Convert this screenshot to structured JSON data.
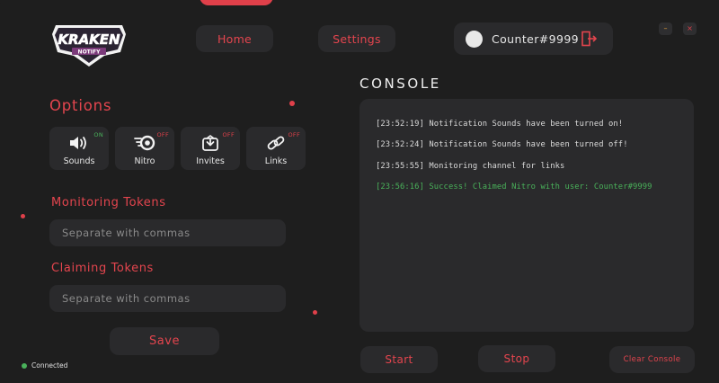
{
  "header": {
    "logo_text": "KRAKEN",
    "logo_subtext": "NOTIFY",
    "nav": {
      "home_label": "Home",
      "settings_label": "Settings"
    },
    "user": {
      "name": "Counter#9999"
    },
    "window": {
      "minimize_glyph": "–",
      "close_glyph": "×"
    }
  },
  "options": {
    "title": "Options",
    "tiles": [
      {
        "label": "Sounds",
        "status": "ON",
        "icon": "speaker-icon"
      },
      {
        "label": "Nitro",
        "status": "OFF",
        "icon": "nitro-icon"
      },
      {
        "label": "Invites",
        "status": "OFF",
        "icon": "invite-icon"
      },
      {
        "label": "Links",
        "status": "OFF",
        "icon": "link-icon"
      }
    ]
  },
  "tokens": {
    "monitoring_label": "Monitoring Tokens",
    "monitoring_placeholder": "Separate with commas",
    "claiming_label": "Claiming Tokens",
    "claiming_placeholder": "Separate with commas",
    "save_label": "Save"
  },
  "status": {
    "text": "Connected"
  },
  "console": {
    "title": "CONSOLE",
    "lines": [
      {
        "text": "[23:52:19] Notification Sounds have been turned on!"
      },
      {
        "text": "[23:52:24] Notification Sounds have been turned off!"
      },
      {
        "text": "[23:55:55] Monitoring channel for links"
      },
      {
        "text": "[23:56:16] Success! Claimed Nitro with user: Counter#9999"
      }
    ],
    "start_label": "Start",
    "stop_label": "Stop",
    "clear_label": "Clear Console"
  },
  "colors": {
    "accent": "#e4454e",
    "background": "#1e1e1e",
    "panel": "#2a2a2c",
    "success": "#49b15a",
    "warning": "#e8a23a"
  }
}
